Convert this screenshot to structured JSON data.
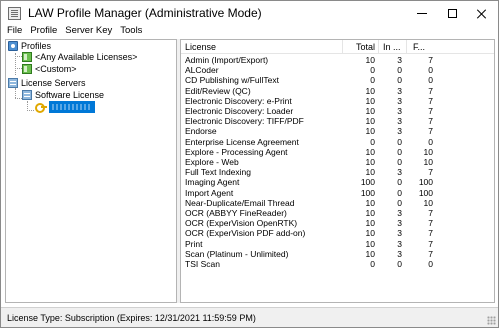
{
  "window": {
    "title": "LAW Profile Manager (Administrative Mode)",
    "app_icon": "list-document-icon",
    "controls": {
      "minimize": "minimize-icon",
      "maximize": "maximize-icon",
      "close": "close-icon"
    }
  },
  "menu": {
    "items": [
      {
        "label": "File"
      },
      {
        "label": "Profile"
      },
      {
        "label": "Server Key"
      },
      {
        "label": "Tools"
      }
    ]
  },
  "tree": {
    "profiles": {
      "label": "Profiles",
      "icon": "profiles-icon"
    },
    "any_available": {
      "label": "<Any Available Licenses>",
      "icon": "license-group-icon"
    },
    "custom": {
      "label": "<Custom>",
      "icon": "license-group-icon"
    },
    "license_servers": {
      "label": "License Servers",
      "icon": "server-icon"
    },
    "software_license": {
      "label": "Software License",
      "icon": "server-icon"
    },
    "selected_key": {
      "label": "",
      "icon": "key-icon",
      "selected": true
    }
  },
  "list": {
    "columns": {
      "license": "License",
      "total": "Total",
      "in_use": "In ...",
      "free": "F..."
    },
    "rows": [
      {
        "name": "Admin (Import/Export)",
        "total": "10",
        "in_use": "3",
        "free": "7"
      },
      {
        "name": "ALCoder",
        "total": "0",
        "in_use": "0",
        "free": "0"
      },
      {
        "name": "CD Publishing w/FullText",
        "total": "0",
        "in_use": "0",
        "free": "0"
      },
      {
        "name": "Edit/Review (QC)",
        "total": "10",
        "in_use": "3",
        "free": "7"
      },
      {
        "name": "Electronic Discovery: e-Print",
        "total": "10",
        "in_use": "3",
        "free": "7"
      },
      {
        "name": "Electronic Discovery: Loader",
        "total": "10",
        "in_use": "3",
        "free": "7"
      },
      {
        "name": "Electronic Discovery: TIFF/PDF",
        "total": "10",
        "in_use": "3",
        "free": "7"
      },
      {
        "name": "Endorse",
        "total": "10",
        "in_use": "3",
        "free": "7"
      },
      {
        "name": "Enterprise License Agreement",
        "total": "0",
        "in_use": "0",
        "free": "0"
      },
      {
        "name": "Explore - Processing Agent",
        "total": "10",
        "in_use": "0",
        "free": "10"
      },
      {
        "name": "Explore - Web",
        "total": "10",
        "in_use": "0",
        "free": "10"
      },
      {
        "name": "Full Text Indexing",
        "total": "10",
        "in_use": "3",
        "free": "7"
      },
      {
        "name": "Imaging Agent",
        "total": "100",
        "in_use": "0",
        "free": "100"
      },
      {
        "name": "Import Agent",
        "total": "100",
        "in_use": "0",
        "free": "100"
      },
      {
        "name": "Near-Duplicate/Email Thread",
        "total": "10",
        "in_use": "0",
        "free": "10"
      },
      {
        "name": "OCR (ABBYY FineReader)",
        "total": "10",
        "in_use": "3",
        "free": "7"
      },
      {
        "name": "OCR (ExperVision OpenRTK)",
        "total": "10",
        "in_use": "3",
        "free": "7"
      },
      {
        "name": "OCR (ExperVision PDF add-on)",
        "total": "10",
        "in_use": "3",
        "free": "7"
      },
      {
        "name": "Print",
        "total": "10",
        "in_use": "3",
        "free": "7"
      },
      {
        "name": "Scan (Platinum - Unlimited)",
        "total": "10",
        "in_use": "3",
        "free": "7"
      },
      {
        "name": "TSI Scan",
        "total": "0",
        "in_use": "0",
        "free": "0"
      }
    ]
  },
  "status": {
    "text": "License Type:  Subscription (Expires: 12/31/2021 11:59:59 PM)"
  },
  "colors": {
    "selection": "#0078d7",
    "statusbar_bg": "#f0f0f0"
  }
}
